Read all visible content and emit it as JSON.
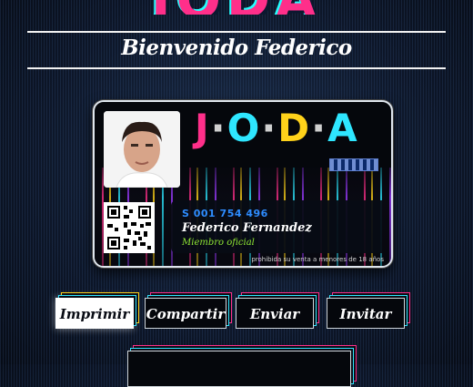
{
  "header": {
    "logo_text": "JODA"
  },
  "welcome": {
    "text": "Bienvenido Federico"
  },
  "card": {
    "logo": {
      "j": "J",
      "o": "O",
      "d": "D",
      "a": "A",
      "dot": "·"
    },
    "number": "S 001 754 496",
    "name": "Federico Fernandez",
    "role": "Miembro oficial",
    "legal": "prohibida su venta a menores de 18 años"
  },
  "actions": {
    "print_label": "Imprimir",
    "share_label": "Compartir",
    "send_label": "Enviar",
    "invite_label": "Invitar"
  },
  "colors": {
    "pink": "#ff2f8a",
    "cyan": "#2ee6ff",
    "yellow": "#ffd21a",
    "green": "#8fe634",
    "blue": "#2e8cff"
  }
}
